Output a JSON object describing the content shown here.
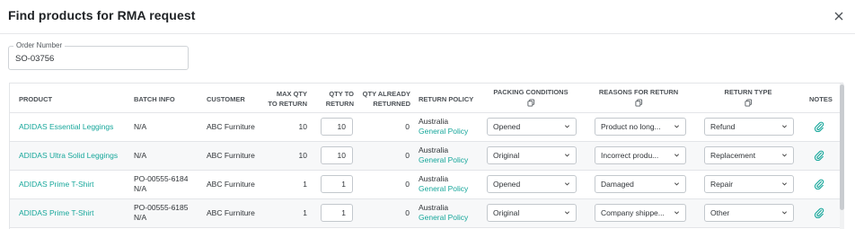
{
  "modal": {
    "title": "Find products for RMA request"
  },
  "order": {
    "legend": "Order Number",
    "value": "SO-03756"
  },
  "columns": {
    "product": "PRODUCT",
    "batch": "BATCH INFO",
    "customer": "CUSTOMER",
    "max_qty_1": "MAX QTY",
    "max_qty_2": "TO RETURN",
    "qty_to_1": "QTY TO",
    "qty_to_2": "RETURN",
    "qty_already_1": "QTY ALREADY",
    "qty_already_2": "RETURNED",
    "policy": "RETURN POLICY",
    "packing": "PACKING CONDITIONS",
    "reasons": "REASONS FOR RETURN",
    "return_type": "RETURN TYPE",
    "notes": "NOTES"
  },
  "rows": [
    {
      "product": "ADIDAS Essential Leggings",
      "batch_1": "N/A",
      "batch_2": "",
      "customer": "ABC Furniture",
      "max_qty": "10",
      "qty_to_return": "10",
      "qty_already": "0",
      "policy_region": "Australia",
      "policy_link": "General Policy",
      "packing": "Opened",
      "reason": "Product no long...",
      "return_type": "Refund"
    },
    {
      "product": "ADIDAS Ultra Solid Leggings",
      "batch_1": "N/A",
      "batch_2": "",
      "customer": "ABC Furniture",
      "max_qty": "10",
      "qty_to_return": "10",
      "qty_already": "0",
      "policy_region": "Australia",
      "policy_link": "General Policy",
      "packing": "Original",
      "reason": "Incorrect produ...",
      "return_type": "Replacement"
    },
    {
      "product": "ADIDAS Prime T-Shirt",
      "batch_1": "PO-00555-6184",
      "batch_2": "N/A",
      "customer": "ABC Furniture",
      "max_qty": "1",
      "qty_to_return": "1",
      "qty_already": "0",
      "policy_region": "Australia",
      "policy_link": "General Policy",
      "packing": "Opened",
      "reason": "Damaged",
      "return_type": "Repair"
    },
    {
      "product": "ADIDAS Prime T-Shirt",
      "batch_1": "PO-00555-6185",
      "batch_2": "N/A",
      "customer": "ABC Furniture",
      "max_qty": "1",
      "qty_to_return": "1",
      "qty_already": "0",
      "policy_region": "Australia",
      "policy_link": "General Policy",
      "packing": "Original",
      "reason": "Company shippe...",
      "return_type": "Other"
    }
  ],
  "icons": {
    "close": "close-icon",
    "copy": "copy-icon",
    "chevron": "chevron-down-icon",
    "notes": "paperclip-icon"
  },
  "colors": {
    "accent": "#17a79b",
    "border": "#e3e5e8",
    "row_alt": "#f7f8f9"
  }
}
